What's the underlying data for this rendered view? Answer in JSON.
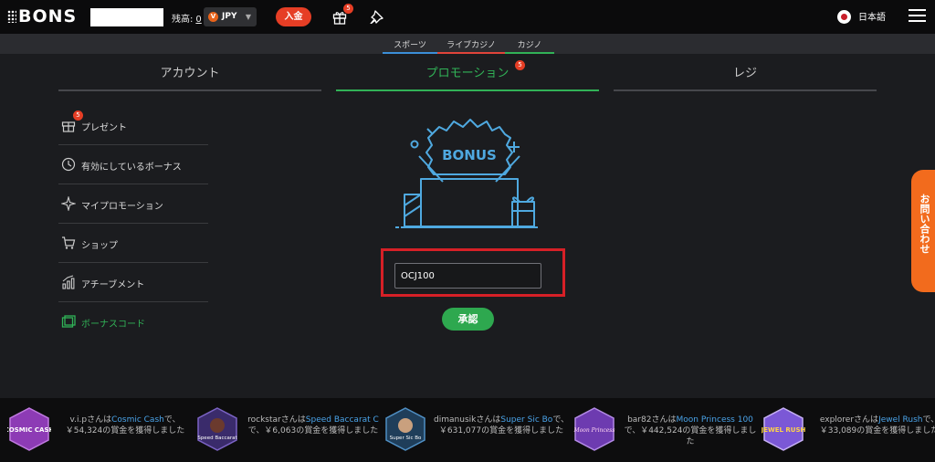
{
  "header": {
    "logo": "BONS",
    "balance_label": "残高:",
    "balance_value": "0",
    "currency": "JPY",
    "deposit_label": "入金",
    "gift_badge": "5",
    "language": "日本語"
  },
  "subnav": {
    "items": [
      {
        "label": "スポーツ",
        "color": "#3b8fd8"
      },
      {
        "label": "ライブカジノ",
        "color": "#e0443a"
      },
      {
        "label": "カジノ",
        "color": "#31b257"
      }
    ]
  },
  "tabs": [
    {
      "label": "アカウント",
      "active": false
    },
    {
      "label": "プロモーション",
      "active": true,
      "badge": "5"
    },
    {
      "label": "レジ",
      "active": false
    }
  ],
  "sidebar": {
    "items": [
      {
        "label": "プレゼント",
        "icon": "gift-icon",
        "badge": "5"
      },
      {
        "label": "有効にしているボーナス",
        "icon": "bonus-clock-icon"
      },
      {
        "label": "マイプロモーション",
        "icon": "sparkle-icon"
      },
      {
        "label": "ショップ",
        "icon": "cart-icon"
      },
      {
        "label": "アチーブメント",
        "icon": "chart-icon"
      },
      {
        "label": "ボーナスコード",
        "icon": "code-icon",
        "active": true
      }
    ]
  },
  "promo": {
    "art_text": "BONUS",
    "code_value": "OCJ100",
    "submit_label": "承認"
  },
  "contact_label": "お問い合わせ",
  "ticker": [
    {
      "user": "v.i.p",
      "mid": "さんは",
      "game": "Cosmic Cash",
      "rest": "で、￥54,324の賞金を獲得しました",
      "thumb": "COSMIC CASH"
    },
    {
      "user": "rockstar",
      "mid": "さんは",
      "game": "Speed Baccarat C",
      "rest": "で、￥6,063の賞金を獲得しました",
      "thumb": "Speed Baccarat"
    },
    {
      "user": "dimanusik",
      "mid": "さんは",
      "game": "Super Sic Bo",
      "rest": "で、￥631,077の賞金を獲得しました",
      "thumb": "Super Sic Bo"
    },
    {
      "user": "bar82",
      "mid": "さんは",
      "game": "Moon Princess 100",
      "rest": "で、￥442,524の賞金を獲得しました",
      "thumb": "Moon Princess"
    },
    {
      "user": "explorer",
      "mid": "さんは",
      "game": "Jewel Rush",
      "rest": "で、￥33,089の賞金を獲得しました",
      "thumb": "JEWEL RUSH"
    }
  ]
}
